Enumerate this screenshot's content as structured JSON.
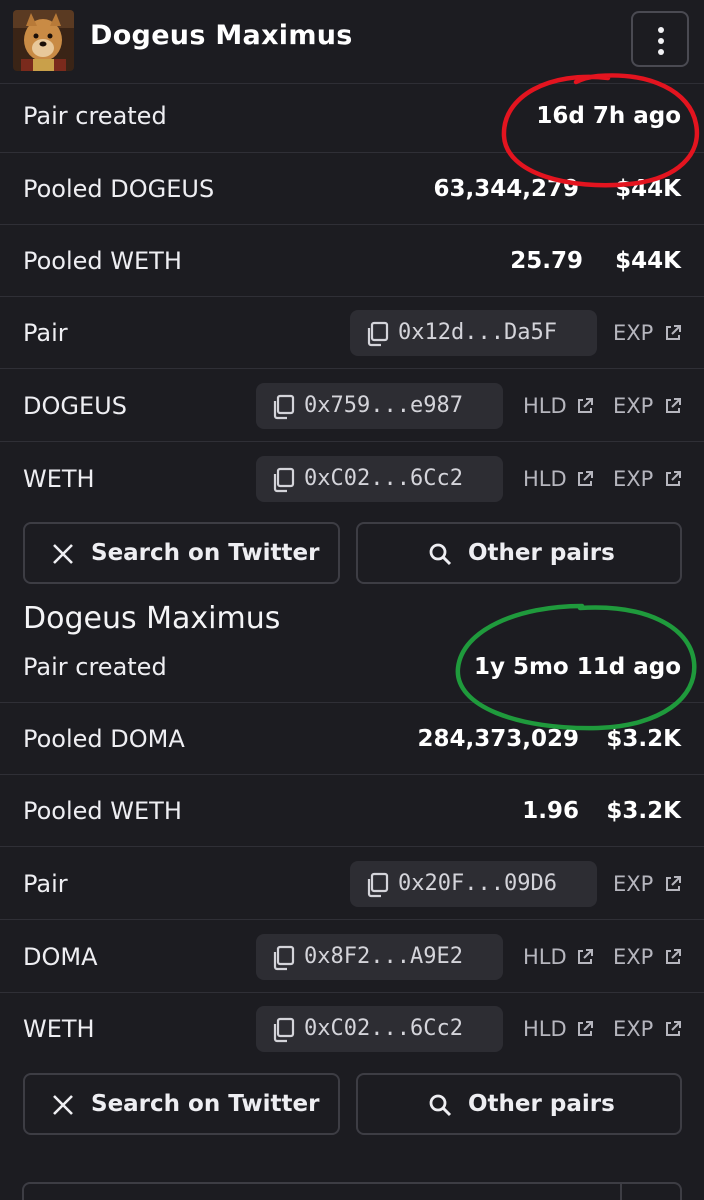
{
  "header": {
    "title": "Dogeus Maximus"
  },
  "pairs": [
    {
      "created_label": "Pair created",
      "created_value": "16d 7h ago",
      "pooled_token_label": "Pooled DOGEUS",
      "pooled_token_amount": "63,344,279",
      "pooled_token_usd": "$44K",
      "pooled_weth_label": "Pooled WETH",
      "pooled_weth_amount": "25.79",
      "pooled_weth_usd": "$44K",
      "pair_label": "Pair",
      "pair_address": "0x12d...Da5F",
      "token_label": "DOGEUS",
      "token_address": "0x759...e987",
      "weth_label": "WETH",
      "weth_address": "0xC02...6Cc2"
    },
    {
      "section_title": "Dogeus Maximus",
      "created_label": "Pair created",
      "created_value": "1y 5mo 11d ago",
      "pooled_token_label": "Pooled DOMA",
      "pooled_token_amount": "284,373,029",
      "pooled_token_usd": "$3.2K",
      "pooled_weth_label": "Pooled WETH",
      "pooled_weth_amount": "1.96",
      "pooled_weth_usd": "$3.2K",
      "pair_label": "Pair",
      "pair_address": "0x20F...09D6",
      "token_label": "DOMA",
      "token_address": "0x8F2...A9E2",
      "weth_label": "WETH",
      "weth_address": "0xC02...6Cc2"
    }
  ],
  "links": {
    "holders": "HLD",
    "explorer": "EXP"
  },
  "buttons": {
    "twitter": "Search on Twitter",
    "other_pairs": "Other pairs"
  },
  "colors": {
    "background": "#1c1c21",
    "row_divider": "#2f2f36",
    "address_chip": "#2d2d33",
    "annotation_red": "#e3141f",
    "annotation_green": "#1f9a3c"
  },
  "icons": {
    "menu": "kebab-menu-icon",
    "copy": "copy-icon",
    "external_link": "external-link-icon",
    "twitter": "x-logo-icon",
    "search": "search-icon"
  }
}
